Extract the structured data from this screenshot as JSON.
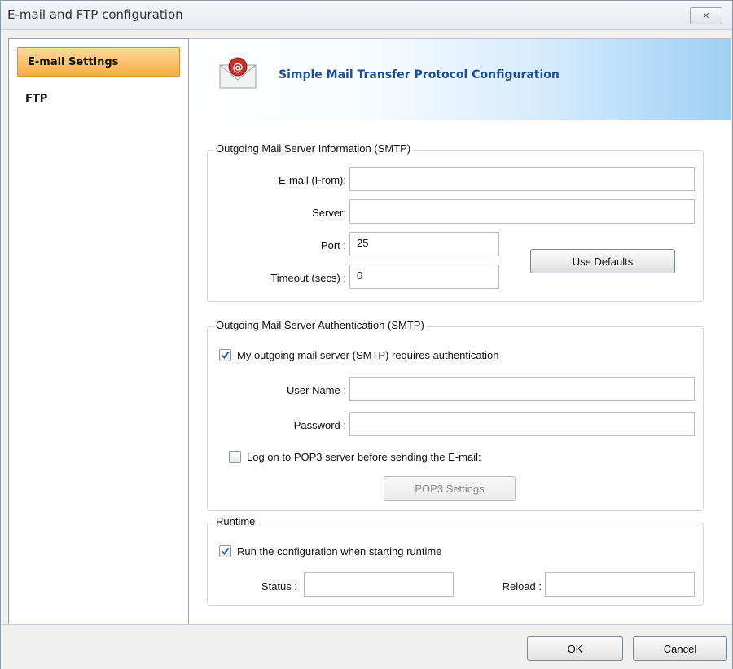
{
  "window": {
    "title": "E-mail and FTP configuration",
    "close_label": "✕"
  },
  "sidebar": {
    "items": [
      {
        "label": "E-mail Settings",
        "selected": true
      },
      {
        "label": "FTP",
        "selected": false
      }
    ]
  },
  "banner": {
    "title": "Simple Mail Transfer Protocol Configuration",
    "icon": "mail-envelope-icon"
  },
  "smtp": {
    "group_title": "Outgoing Mail Server Information (SMTP)",
    "email_label": "E-mail (From):",
    "email_value": "",
    "server_label": "Server:",
    "server_value": "",
    "port_label": "Port :",
    "port_value": "25",
    "timeout_label": "Timeout (secs) :",
    "timeout_value": "0",
    "use_defaults_label": "Use Defaults"
  },
  "auth": {
    "group_title": "Outgoing Mail Server Authentication (SMTP)",
    "requires_auth_label": "My outgoing mail server (SMTP) requires authentication",
    "requires_auth_checked": true,
    "username_label": "User Name :",
    "username_value": "",
    "password_label": "Password :",
    "password_value": "",
    "pop3_label": "Log on to POP3 server before sending the E-mail:",
    "pop3_checked": false,
    "pop3_settings_label": "POP3 Settings"
  },
  "runtime": {
    "group_title": "Runtime",
    "run_label": "Run the configuration when starting runtime",
    "run_checked": true,
    "status_label": "Status :",
    "status_value": "",
    "reload_label": "Reload :",
    "reload_value": ""
  },
  "footer": {
    "ok_label": "OK",
    "cancel_label": "Cancel"
  },
  "colors": {
    "selection_accent": "#f7ac45",
    "banner_title": "#1d4f93",
    "check_mark": "#2a5fa8"
  }
}
